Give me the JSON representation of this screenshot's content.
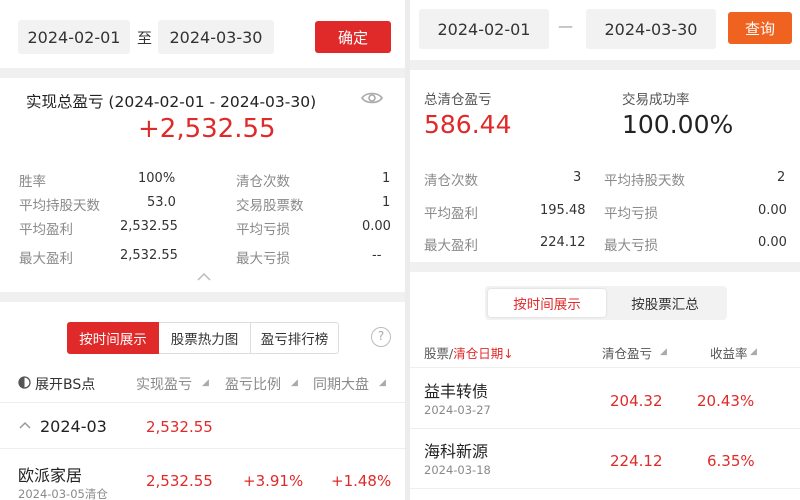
{
  "left": {
    "start_date": "2024-02-01",
    "range_sep": "至",
    "end_date": "2024-03-30",
    "confirm_label": "确定",
    "summary_title": "实现总盈亏 (2024-02-01 - 2024-03-30)",
    "total_pnl": "+2,532.55",
    "stats": [
      {
        "label": "胜率",
        "value": "100%"
      },
      {
        "label": "清仓次数",
        "value": "1"
      },
      {
        "label": "平均持股天数",
        "value": "53.0"
      },
      {
        "label": "交易股票数",
        "value": "1"
      },
      {
        "label": "平均盈利",
        "value": "2,532.55"
      },
      {
        "label": "平均亏损",
        "value": "0.00"
      },
      {
        "label": "最大盈利",
        "value": "2,532.55"
      },
      {
        "label": "最大亏损",
        "value": "--"
      }
    ],
    "tabs": [
      "按时间展示",
      "股票热力图",
      "盈亏排行榜"
    ],
    "help_glyph": "?",
    "columns": [
      "展开BS点",
      "实现盈亏",
      "盈亏比例",
      "同期大盘"
    ],
    "month_group": {
      "month": "2024-03",
      "pnl": "2,532.55"
    },
    "row": {
      "name": "欧派家居",
      "date": "2024-03-05清仓",
      "pnl": "2,532.55",
      "ratio": "+3.91%",
      "market": "+1.48%"
    }
  },
  "right": {
    "start_date": "2024-02-01",
    "range_sep": "—",
    "end_date": "2024-03-30",
    "query_label": "查询",
    "total_label": "总清仓盈亏",
    "total_value": "586.44",
    "success_label": "交易成功率",
    "success_value": "100.00%",
    "stats": [
      {
        "label": "清仓次数",
        "value": "3"
      },
      {
        "label": "平均持股天数",
        "value": "2"
      },
      {
        "label": "平均盈利",
        "value": "195.48"
      },
      {
        "label": "平均亏损",
        "value": "0.00"
      },
      {
        "label": "最大盈利",
        "value": "224.12"
      },
      {
        "label": "最大亏损",
        "value": "0.00"
      }
    ],
    "tabs": [
      "按时间展示",
      "按股票汇总"
    ],
    "col_stock": "股票/",
    "col_date": "清仓日期",
    "col_date_arrow": "↓",
    "col_pnl": "清仓盈亏",
    "col_yield": "收益率",
    "rows": [
      {
        "name": "益丰转债",
        "date": "2024-03-27",
        "pnl": "204.32",
        "yield": "20.43%"
      },
      {
        "name": "海科新源",
        "date": "2024-03-18",
        "pnl": "224.12",
        "yield": "6.35%"
      }
    ]
  },
  "colors": {
    "red": "#e02a2a",
    "orange": "#f0621f",
    "green": "#1a9b3a"
  }
}
